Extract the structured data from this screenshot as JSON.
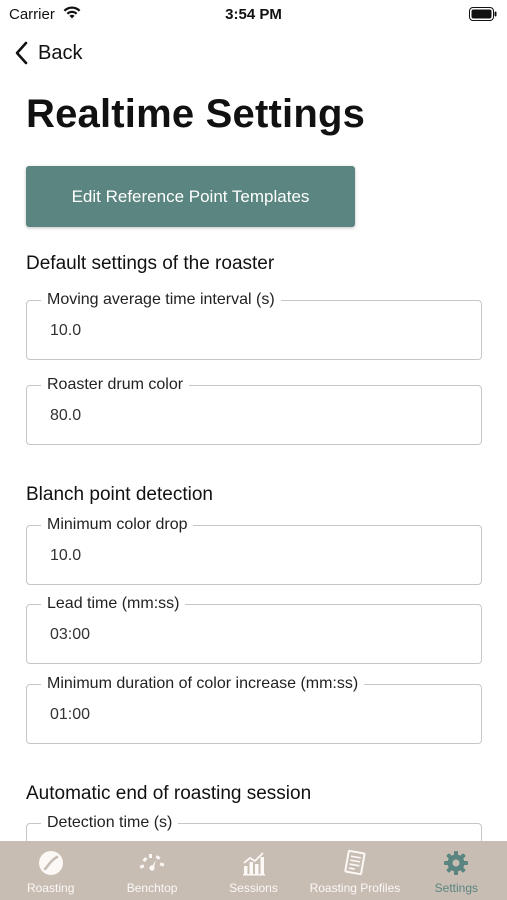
{
  "status_bar": {
    "carrier": "Carrier",
    "time": "3:54 PM"
  },
  "nav": {
    "back_label": "Back"
  },
  "page": {
    "title": "Realtime Settings"
  },
  "edit_templates_button": "Edit Reference Point Templates",
  "sections": {
    "default_settings": {
      "title": "Default settings of the roaster",
      "moving_average": {
        "label": "Moving average time interval (s)",
        "value": "10.0"
      },
      "drum_color": {
        "label": "Roaster drum color",
        "value": "80.0"
      }
    },
    "blanch_detection": {
      "title": "Blanch point detection",
      "min_color_drop": {
        "label": "Minimum color drop",
        "value": "10.0"
      },
      "lead_time": {
        "label": "Lead time (mm:ss)",
        "value": "03:00"
      },
      "min_duration": {
        "label": "Minimum duration of color increase (mm:ss)",
        "value": "01:00"
      }
    },
    "auto_end": {
      "title": "Automatic end of roasting session",
      "detection_time": {
        "label": "Detection time (s)",
        "value": ""
      }
    }
  },
  "tabs": [
    {
      "label": "Roasting",
      "icon": "bean-icon"
    },
    {
      "label": "Benchtop",
      "icon": "gauge-icon"
    },
    {
      "label": "Sessions",
      "icon": "bar-chart-icon"
    },
    {
      "label": "Roasting Profiles",
      "icon": "document-icon"
    },
    {
      "label": "Settings",
      "icon": "gear-icon",
      "active": true
    }
  ],
  "colors": {
    "accent": "#5a8580",
    "tab_bar": "#c8bdb3",
    "tab_inactive": "#fbf8f5"
  }
}
